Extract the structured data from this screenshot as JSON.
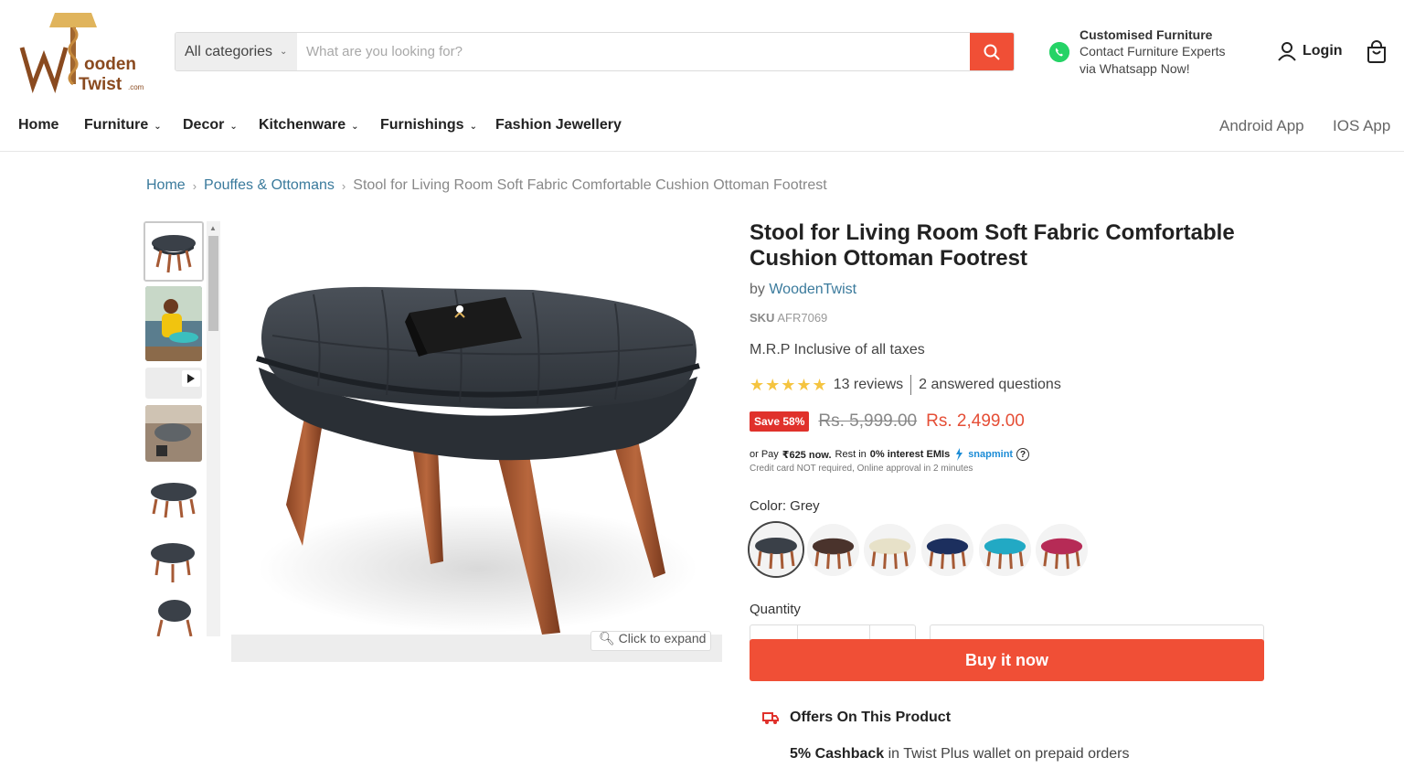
{
  "brand": {
    "logo_name": "Wooden Twist",
    "logo_line1": "ooden",
    "logo_line2": "Twist",
    "logo_suffix": ".com"
  },
  "search": {
    "category": "All categories",
    "placeholder": "What are you looking for?"
  },
  "whatsapp": {
    "title": "Customised Furniture",
    "line1": "Contact Furniture Experts",
    "line2": "via Whatsapp Now!"
  },
  "account": {
    "login_label": "Login"
  },
  "nav": {
    "items": [
      {
        "label": "Home"
      },
      {
        "label": "Furniture"
      },
      {
        "label": "Decor"
      },
      {
        "label": "Kitchenware"
      },
      {
        "label": "Furnishings"
      },
      {
        "label": "Fashion Jewellery"
      }
    ],
    "android": "Android App",
    "ios": "IOS App"
  },
  "breadcrumb": {
    "home": "Home",
    "category": "Pouffes & Ottomans",
    "current": "Stool for Living Room Soft Fabric Comfortable Cushion Ottoman Footrest"
  },
  "gallery": {
    "expand_label": "Click to expand"
  },
  "product": {
    "title": "Stool for Living Room Soft Fabric Comfortable Cushion Ottoman Footrest",
    "by": "by",
    "vendor": "WoodenTwist",
    "sku_label": "SKU",
    "sku": "AFR7069",
    "mrp_note": "M.R.P Inclusive of all taxes",
    "rating": 5,
    "reviews": "13 reviews",
    "questions": "2 answered questions",
    "save_badge": "Save 58%",
    "compare_price": "Rs. 5,999.00",
    "price": "Rs. 2,499.00",
    "emi_prefix": "or Pay",
    "emi_amount": "₹625 now.",
    "emi_mid": "Rest in",
    "emi_interest": "0% interest EMIs",
    "emi_brand": "snapmint",
    "emi_help": "?",
    "emi_sub": "Credit card NOT required, Online approval in 2 minutes",
    "color_label": "Color: Grey",
    "swatches": [
      {
        "color": "#3a4048"
      },
      {
        "color": "#4a332c"
      },
      {
        "color": "#e7e1c8"
      },
      {
        "color": "#1c2f5e"
      },
      {
        "color": "#22a9c4"
      },
      {
        "color": "#b62b56"
      }
    ],
    "quantity_label": "Quantity",
    "buy_label": "Buy it now",
    "offers_title": "Offers On This Product",
    "cashback_bold": "5% Cashback",
    "cashback_rest": " in Twist Plus wallet on prepaid orders"
  },
  "colors": {
    "accent": "#f04f36",
    "link": "#3a7a9c",
    "star": "#f5c440",
    "seat": "#3a4048",
    "legs": "#a65a35"
  }
}
